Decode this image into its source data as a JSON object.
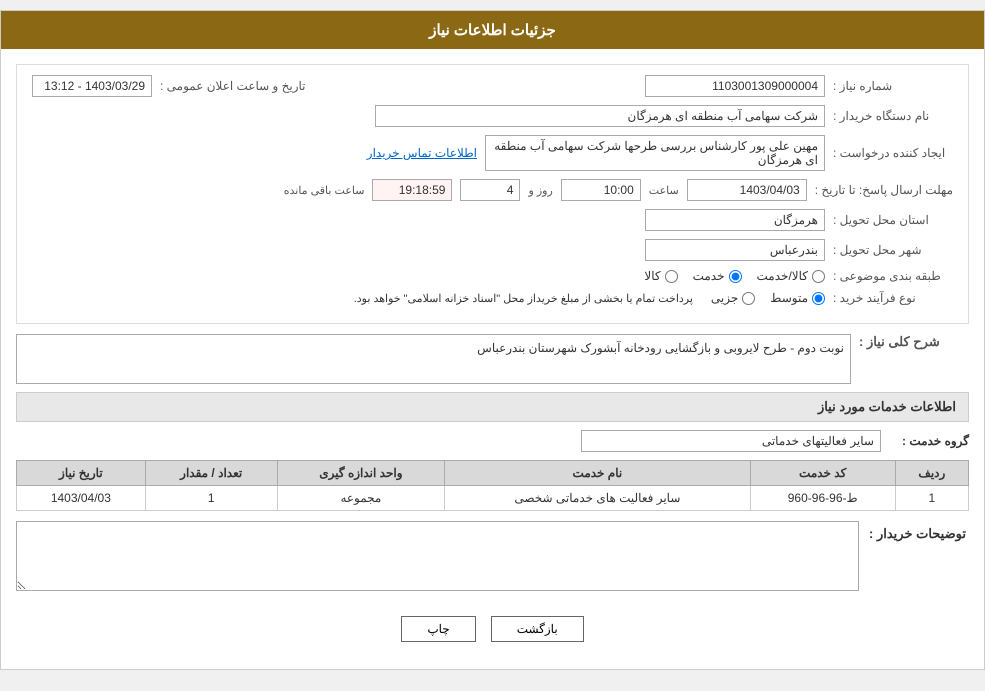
{
  "header": {
    "title": "جزئیات اطلاعات نیاز"
  },
  "fields": {
    "need_number_label": "شماره نیاز :",
    "need_number_value": "1103001309000004",
    "buyer_org_label": "نام دستگاه خریدار :",
    "buyer_org_value": "شرکت سهامی  آب منطقه ای هرمزگان",
    "requester_label": "ایجاد کننده درخواست :",
    "requester_value": "مهین علی پور کارشناس بررسی طرحها شرکت سهامی  آب منطقه ای هرمزگان",
    "contact_link": "اطلاعات تماس خریدار",
    "deadline_label": "مهلت ارسال پاسخ: تا تاریخ :",
    "deadline_date": "1403/04/03",
    "deadline_time_label": "ساعت",
    "deadline_time": "10:00",
    "deadline_day_label": "روز و",
    "deadline_days": "4",
    "deadline_remaining": "19:18:59",
    "deadline_remaining_label": "ساعت باقی مانده",
    "announce_label": "تاریخ و ساعت اعلان عمومی :",
    "announce_value": "1403/03/29 - 13:12",
    "province_label": "استان محل تحویل :",
    "province_value": "هرمزگان",
    "city_label": "شهر محل تحویل :",
    "city_value": "بندرعباس",
    "category_label": "طبقه بندی موضوعی :",
    "category_kala": "کالا",
    "category_khadamat": "خدمت",
    "category_kala_khadamat": "کالا/خدمت",
    "category_selected": "khadamat",
    "purchase_type_label": "نوع فرآیند خرید :",
    "purchase_jozi": "جزیی",
    "purchase_motawaset": "متوسط",
    "purchase_note": "پرداخت تمام یا بخشی از مبلغ خریداز محل \"اسناد خزانه اسلامی\" خواهد بود.",
    "purchase_selected": "motawaset"
  },
  "need_description": {
    "section_title": "شرح کلی نیاز :",
    "value": "نوبت دوم - طرح لایروبی و بازگشایی رودخانه آبشورک شهرستان بندرعباس"
  },
  "services_section": {
    "section_title": "اطلاعات خدمات مورد نیاز",
    "group_label": "گروه خدمت :",
    "group_value": "سایر فعالیتهای خدماتی",
    "table": {
      "headers": [
        "ردیف",
        "کد خدمت",
        "نام خدمت",
        "واحد اندازه گیری",
        "تعداد / مقدار",
        "تاریخ نیاز"
      ],
      "rows": [
        {
          "row_num": "1",
          "service_code": "ط-96-96-960",
          "service_name": "سایر فعالیت های خدماتی شخصی",
          "unit": "مجموعه",
          "quantity": "1",
          "date": "1403/04/03"
        }
      ]
    }
  },
  "buyer_description": {
    "label": "توضیحات خریدار :",
    "value": ""
  },
  "buttons": {
    "print": "چاپ",
    "back": "بازگشت"
  }
}
